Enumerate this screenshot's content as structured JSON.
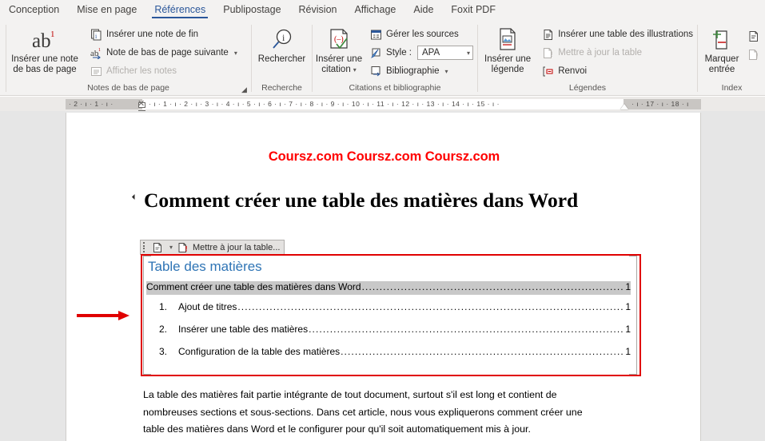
{
  "ribbon": {
    "tabs": [
      {
        "label": "Conception",
        "active": false
      },
      {
        "label": "Mise en page",
        "active": false
      },
      {
        "label": "Références",
        "active": true
      },
      {
        "label": "Publipostage",
        "active": false
      },
      {
        "label": "Révision",
        "active": false
      },
      {
        "label": "Affichage",
        "active": false
      },
      {
        "label": "Aide",
        "active": false
      },
      {
        "label": "Foxit PDF",
        "active": false
      }
    ],
    "groups": {
      "footnotes": {
        "label": "Notes de bas de page",
        "big_button": "Insérer une note\nde bas de page",
        "big_button_line1": "Insérer une note",
        "big_button_line2": "de bas de page",
        "items": [
          {
            "label": "Insérer une note de fin",
            "icon": "insert-endnote-icon",
            "disabled": false,
            "caret": false
          },
          {
            "label": "Note de bas de page suivante",
            "icon": "next-footnote-icon",
            "disabled": false,
            "caret": true
          },
          {
            "label": "Afficher les notes",
            "icon": "show-notes-icon",
            "disabled": true,
            "caret": false
          }
        ]
      },
      "research": {
        "label": "Recherche",
        "big_button": "Rechercher"
      },
      "citations": {
        "label": "Citations et bibliographie",
        "big_button_line1": "Insérer une",
        "big_button_line2": "citation",
        "manage_sources": "Gérer les sources",
        "style_label": "Style :",
        "style_value": "APA",
        "bibliography": "Bibliographie"
      },
      "captions": {
        "label": "Légendes",
        "big_button_line1": "Insérer une",
        "big_button_line2": "légende",
        "items": [
          {
            "label": "Insérer une table des illustrations",
            "icon": "table-of-figures-icon",
            "disabled": false
          },
          {
            "label": "Mettre à jour la table",
            "icon": "update-table-icon",
            "disabled": true
          },
          {
            "label": "Renvoi",
            "icon": "cross-reference-icon",
            "disabled": false
          }
        ]
      },
      "index": {
        "label": "Index",
        "big_button_line1": "Marquer",
        "big_button_line2": "entrée",
        "items": [
          {
            "label": "",
            "icon": "insert-index-icon",
            "disabled": false
          },
          {
            "label": "",
            "icon": "update-index-icon",
            "disabled": true
          }
        ]
      }
    }
  },
  "ruler": {
    "left_numbers": "·  2  ·   ı   ·  1  ·   ı   ·",
    "right_numbers": "·   ı   ·  1  ·   ı   ·  2  ·   ı   ·  3  ·   ı   ·  4  ·   ı   ·  5  ·   ı   ·  6  ·   ı   ·  7  ·   ı   ·  8  ·   ı   ·  9  ·   ı   · 10 ·   ı   · 11 ·   ı   · 12 ·   ı   · 13 ·   ı   · 14 ·   ı   · 15 ·   ı   ·"
  },
  "ruler_tail": "·   ı   · 17 ·   ı   · 18 ·   ı",
  "document": {
    "header_text": "Coursz.com Coursz.com Coursz.com",
    "heading1": "Comment créer une table des matières dans Word",
    "content_control": {
      "button_label": "Mettre à jour la table..."
    },
    "toc": {
      "title": "Table des matières",
      "entries": [
        {
          "number": "",
          "text": "Comment créer une table des matières dans Word ",
          "page": "1",
          "level": 0
        },
        {
          "number": "1.",
          "text": "Ajout de titres",
          "page": "1",
          "level": 1
        },
        {
          "number": "2.",
          "text": "Insérer une table des matières",
          "page": "1",
          "level": 1
        },
        {
          "number": "3.",
          "text": "Configuration de la table des matières ",
          "page": "1",
          "level": 1
        }
      ],
      "leader_dots": "................................................................................................................................................................................................"
    },
    "paragraph": "La table des matières fait partie intégrante de tout document, surtout s'il est long et contient de nombreuses sections et sous-sections. Dans cet article, nous vous expliquerons comment créer une table des matières dans Word et le configurer pour qu'il soit automatiquement mis à jour."
  },
  "annotation": {
    "arrow_color": "#e00000",
    "highlight_color": "#e00000"
  },
  "colors": {
    "ribbon_bg": "#f3f2f1",
    "accent": "#2b579a",
    "toc_title": "#2e74b5",
    "header_red": "#ff0000",
    "page_bg": "#e6e6e6"
  }
}
